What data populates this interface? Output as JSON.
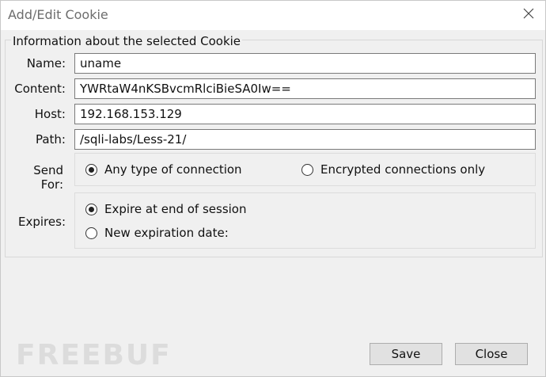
{
  "window": {
    "title": "Add/Edit Cookie"
  },
  "group": {
    "title": "Information about the selected Cookie"
  },
  "fields": {
    "name": {
      "label": "Name:",
      "value": "uname"
    },
    "content": {
      "label": "Content:",
      "value": "YWRtaW4nKSBvcmRlciBieSA0Iw=="
    },
    "host": {
      "label": "Host:",
      "value": "192.168.153.129"
    },
    "path": {
      "label": "Path:",
      "value": "/sqli-labs/Less-21/"
    }
  },
  "send_for": {
    "label": "Send For:",
    "options": [
      {
        "label": "Any type of connection",
        "selected": true
      },
      {
        "label": "Encrypted connections only",
        "selected": false
      }
    ]
  },
  "expires": {
    "label": "Expires:",
    "options": [
      {
        "label": "Expire at end of session",
        "selected": true
      },
      {
        "label": "New expiration date:",
        "selected": false
      }
    ]
  },
  "buttons": {
    "save": "Save",
    "close": "Close"
  },
  "watermark": {
    "text": "FREEBUF"
  },
  "icons": {
    "close": "close-icon",
    "radio_checked": "radio-checked-icon",
    "radio_unchecked": "radio-unchecked-icon"
  },
  "colors": {
    "background": "#f0f0f0",
    "titlebar": "#ffffff",
    "button": "#e1e1e1"
  }
}
